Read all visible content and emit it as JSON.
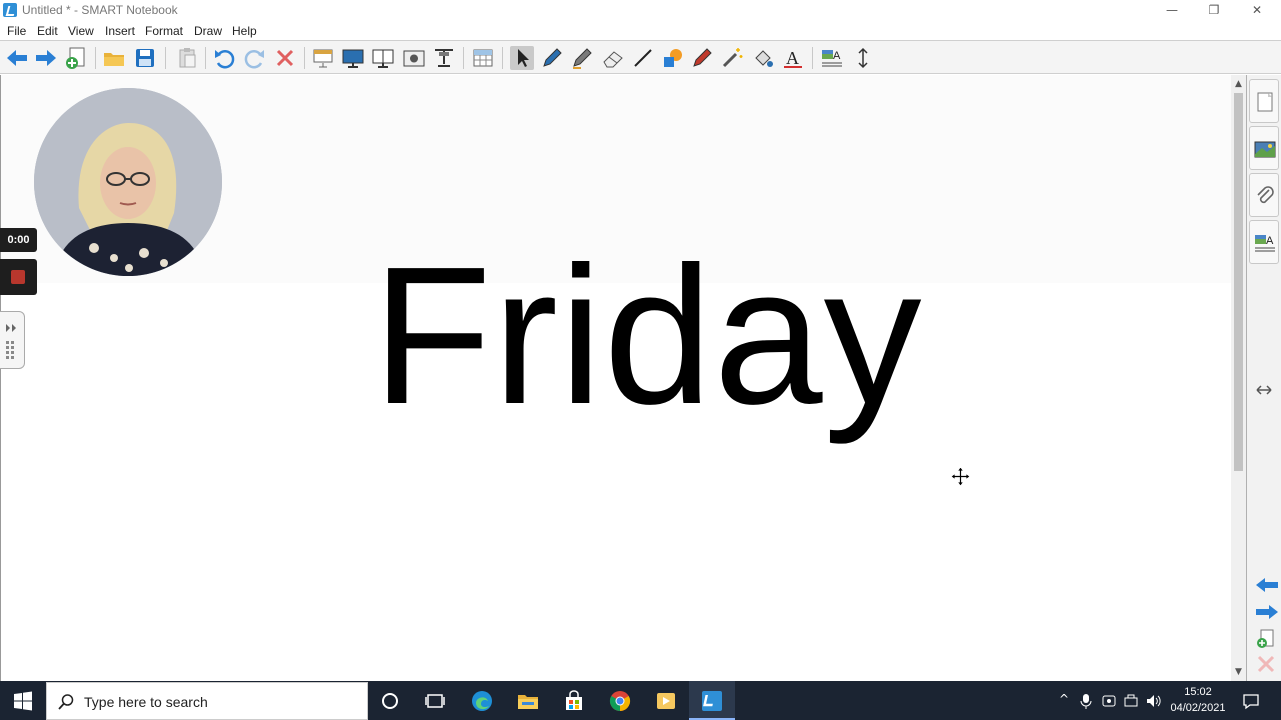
{
  "window": {
    "title": "Untitled * - SMART Notebook",
    "minimize": "—",
    "restore": "❐",
    "close": "✕"
  },
  "menu": {
    "items": [
      "File",
      "Edit",
      "View",
      "Insert",
      "Format",
      "Draw",
      "Help"
    ]
  },
  "toolbar": {
    "tools": [
      "previous-page",
      "next-page",
      "add-page",
      "open",
      "save",
      "paste",
      "undo",
      "redo",
      "delete",
      "screen-shade",
      "full-screen",
      "dual-page",
      "screen-capture",
      "document-camera",
      "table",
      "select",
      "pen",
      "creative-pen",
      "eraser",
      "line",
      "shapes",
      "magic-pen",
      "fill",
      "text",
      "properties",
      "move-toolbar"
    ]
  },
  "canvas": {
    "main_text": "Friday"
  },
  "recording": {
    "timer": "0:00"
  },
  "sidebar": {
    "tabs": [
      "page-sorter",
      "gallery",
      "attachments",
      "properties"
    ],
    "colors": {
      "accent": "#2a7fd4"
    }
  },
  "taskbar": {
    "search_placeholder": "Type here to search",
    "apps": [
      "cortana",
      "task-view",
      "edge",
      "file-explorer",
      "store",
      "chrome",
      "media-player",
      "smart-notebook"
    ],
    "time": "15:02",
    "date": "04/02/2021"
  }
}
